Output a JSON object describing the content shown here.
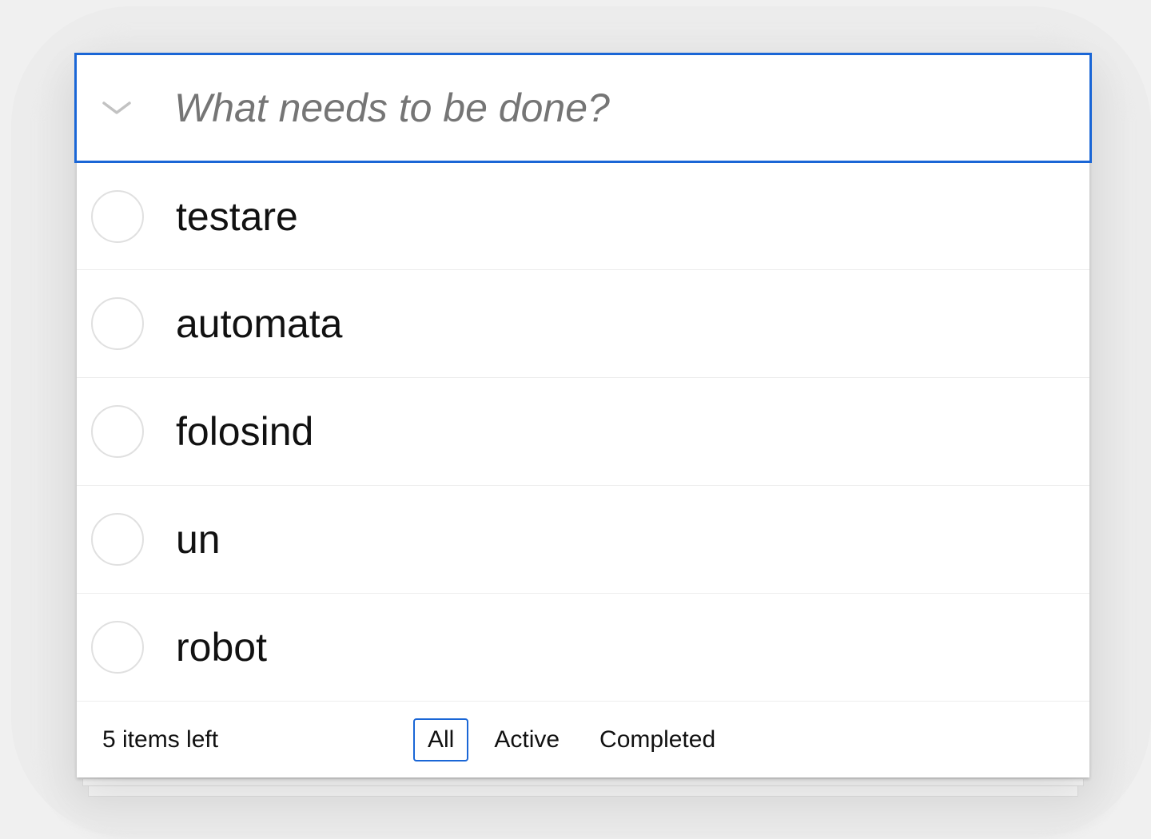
{
  "new_todo": {
    "placeholder": "What needs to be done?",
    "value": ""
  },
  "todos": [
    {
      "label": "testare",
      "completed": false
    },
    {
      "label": "automata",
      "completed": false
    },
    {
      "label": "folosind",
      "completed": false
    },
    {
      "label": "un",
      "completed": false
    },
    {
      "label": "robot",
      "completed": false
    }
  ],
  "footer": {
    "count_text": "5 items left",
    "filters": [
      {
        "label": "All",
        "selected": true
      },
      {
        "label": "Active",
        "selected": false
      },
      {
        "label": "Completed",
        "selected": false
      }
    ]
  },
  "colors": {
    "focus_border": "#1a66d6",
    "background": "#f0f0f0",
    "placeholder": "#757575"
  },
  "icons": {
    "toggle_all": "chevron-down-icon",
    "item_toggle": "empty-circle-checkbox"
  }
}
